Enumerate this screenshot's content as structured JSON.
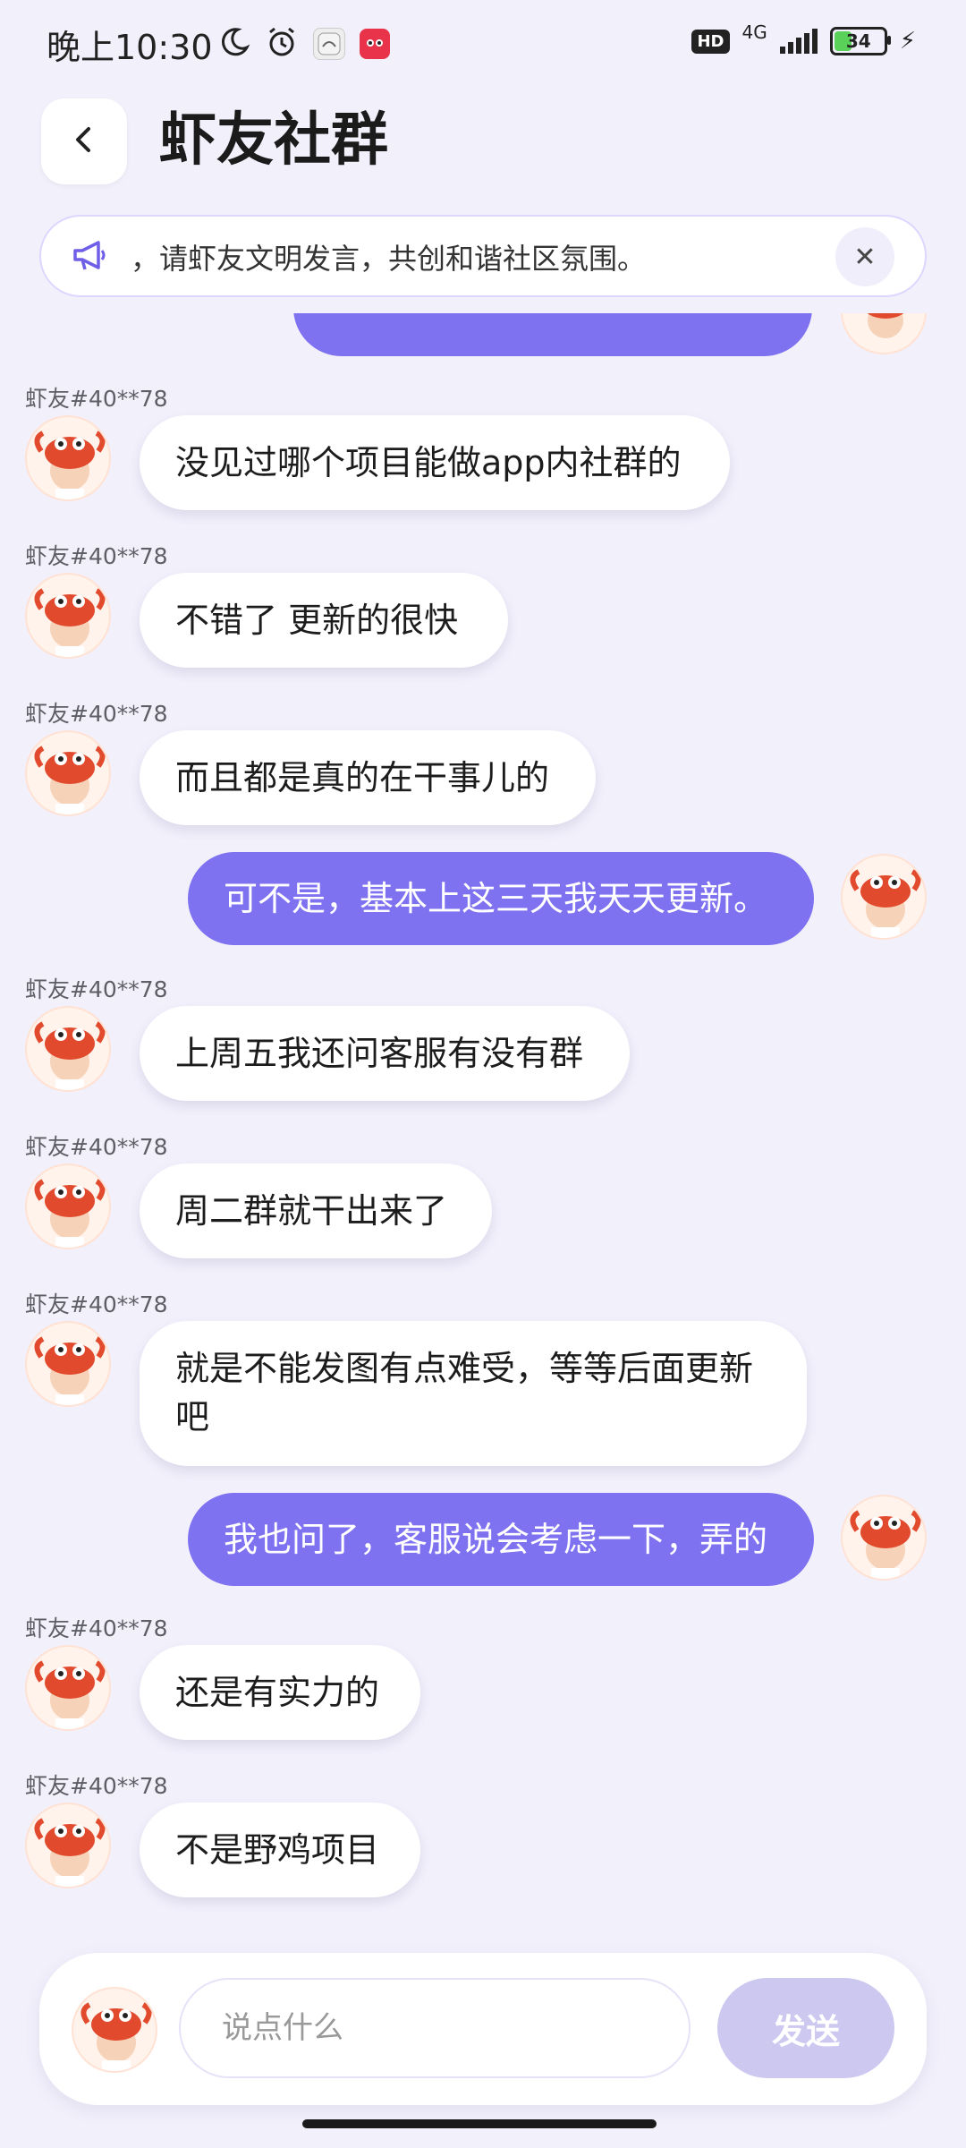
{
  "status_bar": {
    "time": "晚上10:30",
    "hd": "HD",
    "network": "4G",
    "battery": "34"
  },
  "header": {
    "title": "虾友社群"
  },
  "notice": {
    "text": "，请虾友文明发言，共创和谐社区氛围。"
  },
  "messages": [
    {
      "sender": "虾友#40**78",
      "text": "没见过哪个项目能做app内社群的"
    },
    {
      "sender": "虾友#40**78",
      "text": "不错了  更新的很快"
    },
    {
      "sender": "虾友#40**78",
      "text": "而且都是真的在干事儿的"
    },
    {
      "text": "可不是，基本上这三天我天天更新。"
    },
    {
      "sender": "虾友#40**78",
      "text": "上周五我还问客服有没有群"
    },
    {
      "sender": "虾友#40**78",
      "text": "周二群就干出来了"
    },
    {
      "sender": "虾友#40**78",
      "text_line1": "就是不能发图有点难受，等等后面更新",
      "text_line2": "吧"
    },
    {
      "text": "我也问了，客服说会考虑一下，弄的"
    },
    {
      "sender": "虾友#40**78",
      "text": "还是有实力的"
    },
    {
      "sender": "虾友#40**78",
      "text": "不是野鸡项目"
    }
  ],
  "composer": {
    "placeholder": "说点什么",
    "send_label": "发送"
  },
  "colors": {
    "accent": "#7f72f0",
    "background": "#f2f0fb",
    "send_disabled": "#cdc8ef"
  },
  "icons": [
    "moon-icon",
    "alarm-icon",
    "app-icon",
    "app-icon",
    "hd-icon",
    "signal-icon",
    "battery-icon",
    "charging-icon",
    "back-icon",
    "megaphone-icon",
    "close-icon",
    "avatar-icon"
  ]
}
